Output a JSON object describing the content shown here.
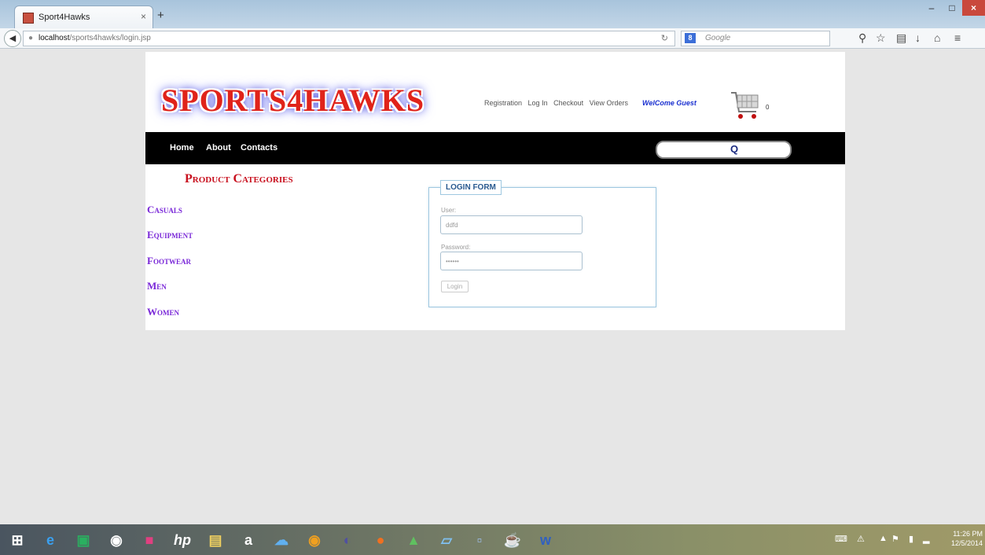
{
  "browser": {
    "tab_title": "Sport4Hawks",
    "url_host": "localhost",
    "url_path": "/sports4hawks/login.jsp",
    "search_engine_placeholder": "Google",
    "new_tab_glyph": "+",
    "tab_close_glyph": "×",
    "window_buttons": {
      "minimize": "–",
      "maximize": "□",
      "close": "×"
    }
  },
  "site": {
    "logo_text": "SPORTS4HAWKS",
    "top_links": [
      "Registration",
      "Log In",
      "Checkout",
      "View Orders"
    ],
    "welcome_text": "WelCome Guest",
    "cart_count": "0",
    "nav_items": [
      "Home",
      "About",
      "Contacts"
    ],
    "search_button_glyph": "Q"
  },
  "categories": {
    "heading": "Product Categories",
    "items": [
      "Casuals",
      "Equipment",
      "Footwear",
      "Men",
      "Women"
    ]
  },
  "login": {
    "legend": "LOGIN FORM",
    "user_label": "User:",
    "user_value": "ddfd",
    "password_label": "Password:",
    "password_value": "••••••",
    "button_label": "Login"
  },
  "taskbar": {
    "time": "11:26 PM",
    "date": "12/5/2014"
  },
  "colors": {
    "nav_bg": "#000000",
    "category_heading": "#c8101e",
    "category_item": "#7a28d8",
    "welcome": "#1a30d0",
    "logo": "#e0231a"
  }
}
